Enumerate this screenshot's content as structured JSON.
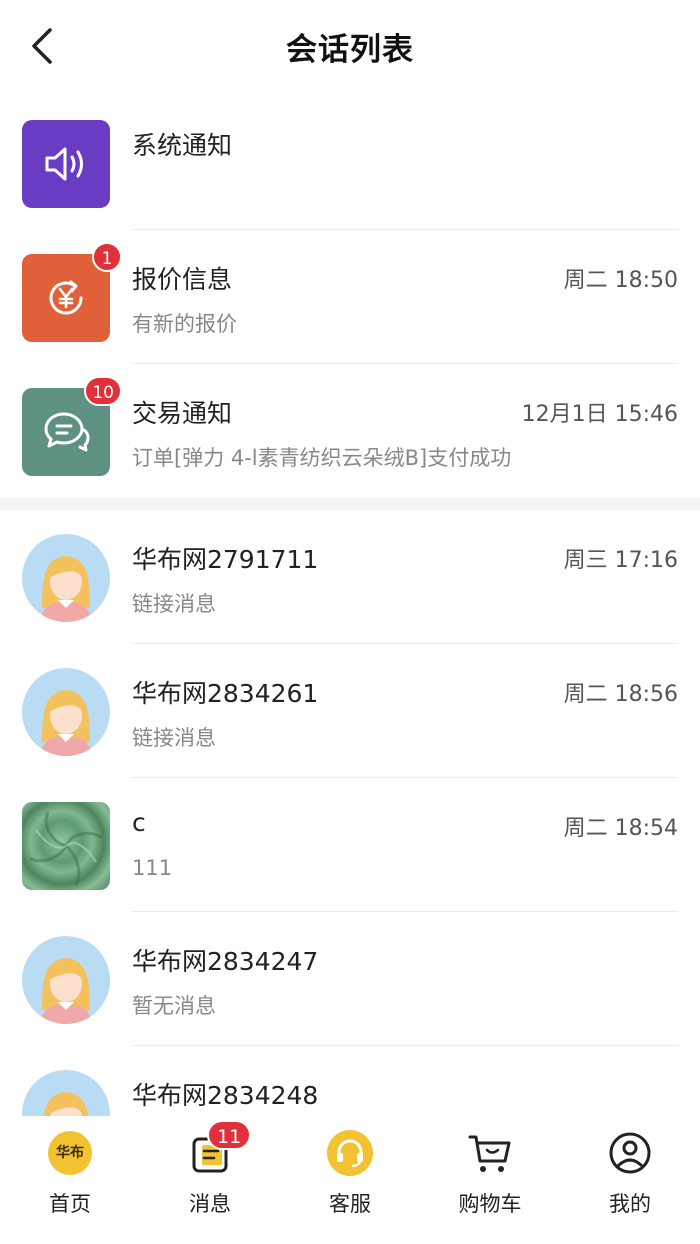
{
  "header": {
    "title": "会话列表"
  },
  "system": [
    {
      "name": "系统通知",
      "time": "",
      "preview": "",
      "badge": "",
      "color": "#6a3cc4",
      "icon": "speaker-icon"
    },
    {
      "name": "报价信息",
      "time": "周二 18:50",
      "preview": "有新的报价",
      "badge": "1",
      "color": "#e0603a",
      "icon": "yen-refresh-icon"
    },
    {
      "name": "交易通知",
      "time": "12月1日 15:46",
      "preview": "订单[弹力 4-l素青纺织云朵绒B]支付成功",
      "badge": "10",
      "color": "#5e9181",
      "icon": "chat-bubbles-icon"
    }
  ],
  "chats": [
    {
      "name": "华布网2791711",
      "time": "周三 17:16",
      "preview": "链接消息",
      "avatar": "girl-avatar"
    },
    {
      "name": "华布网2834261",
      "time": "周二 18:56",
      "preview": "链接消息",
      "avatar": "girl-avatar"
    },
    {
      "name": "c",
      "time": "周二 18:54",
      "preview": "111",
      "avatar": "fabric-photo"
    },
    {
      "name": "华布网2834247",
      "time": "",
      "preview": "暂无消息",
      "avatar": "girl-avatar"
    },
    {
      "name": "华布网2834248",
      "time": "",
      "preview": "",
      "avatar": "girl-avatar"
    }
  ],
  "tabbar": {
    "home": {
      "label": "首页",
      "logo_text": "华布"
    },
    "messages": {
      "label": "消息",
      "badge": "11"
    },
    "service": {
      "label": "客服"
    },
    "cart": {
      "label": "购物车"
    },
    "mine": {
      "label": "我的"
    }
  },
  "colors": {
    "accent_yellow": "#f2c230",
    "badge_red": "#e0303b"
  }
}
